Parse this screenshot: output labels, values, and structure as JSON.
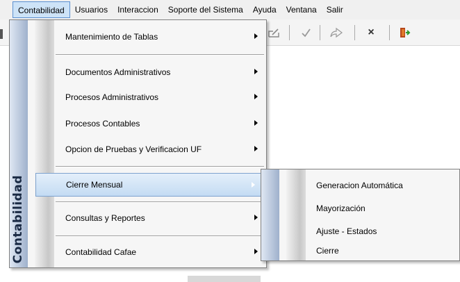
{
  "menubar": {
    "items": [
      "Contabilidad",
      "Usuarios",
      "Interaccion",
      "Soporte del Sistema",
      "Ayuda",
      "Ventana",
      "Salir"
    ]
  },
  "toolbar": {
    "icons": [
      "edit-icon",
      "check-icon",
      "undo-icon",
      "close-icon",
      "exit-door-icon"
    ],
    "close_glyph": "×"
  },
  "dropdown": {
    "side_label": "Contabilidad",
    "items": [
      {
        "label": "Mantenimiento de Tablas",
        "submenu": true
      },
      {
        "label": "Documentos Administrativos",
        "submenu": true
      },
      {
        "label": "Procesos Administrativos",
        "submenu": true
      },
      {
        "label": "Procesos Contables",
        "submenu": true
      },
      {
        "label": "Opcion de Pruebas y Verificacion UF",
        "submenu": true
      },
      {
        "label": "Cierre Mensual",
        "submenu": true,
        "highlighted": true
      },
      {
        "label": "Consultas y Reportes",
        "submenu": true
      },
      {
        "label": "Contabilidad Cafae",
        "submenu": true
      }
    ]
  },
  "submenu": {
    "items": [
      "Generacion Automática",
      "Mayorización",
      "Ajuste - Estados",
      "Cierre"
    ]
  },
  "colors": {
    "highlight": "#c3dbf3",
    "highlight_border": "#7da2ce",
    "side_strip": "#9fb1cc"
  }
}
